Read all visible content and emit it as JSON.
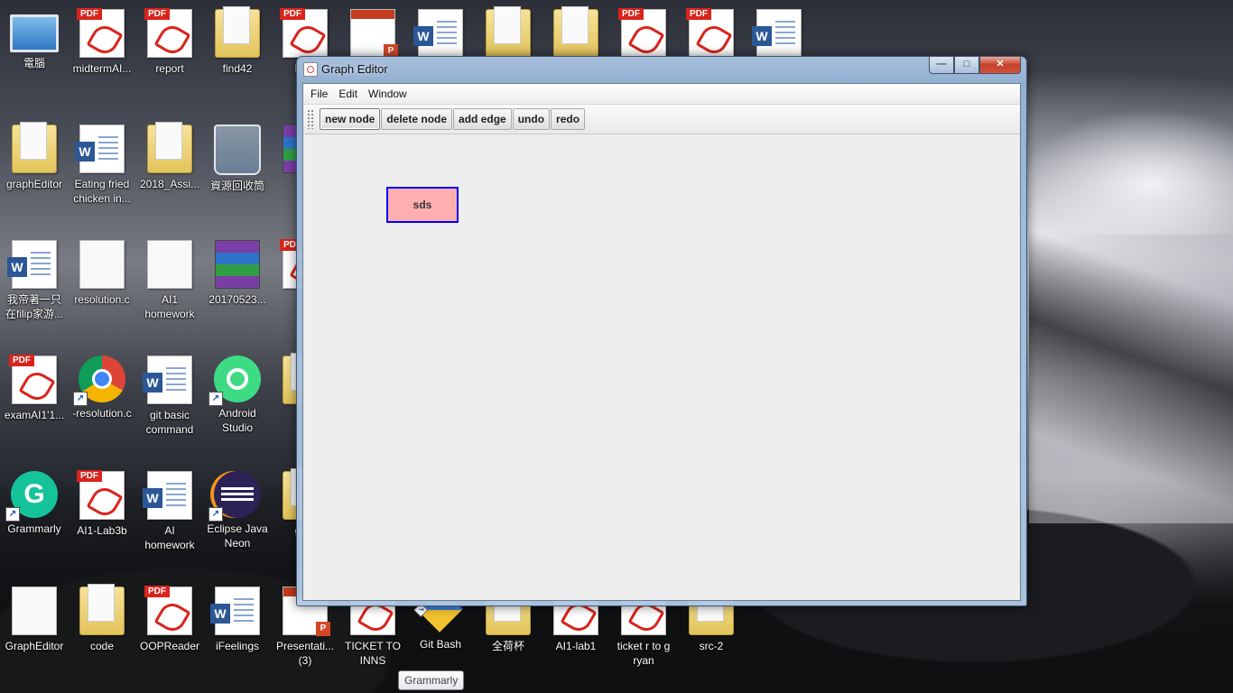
{
  "desktop": {
    "icons": [
      {
        "label": "電腦",
        "type": "computer"
      },
      {
        "label": "midtermAI...",
        "type": "pdf"
      },
      {
        "label": "report",
        "type": "pdf-folder"
      },
      {
        "label": "find42",
        "type": "folder"
      },
      {
        "label": "key-",
        "type": "pdf"
      },
      {
        "label": "",
        "type": "ppt"
      },
      {
        "label": "",
        "type": "word"
      },
      {
        "label": "",
        "type": "folder"
      },
      {
        "label": "",
        "type": "folder"
      },
      {
        "label": "",
        "type": "pdf"
      },
      {
        "label": "",
        "type": "pdf"
      },
      {
        "label": "",
        "type": "word"
      },
      {
        "label": "graphEditor",
        "type": "folder"
      },
      {
        "label": "Eating fried\nchicken in...",
        "type": "word"
      },
      {
        "label": "2018_Assi...",
        "type": "folder"
      },
      {
        "label": "資源回收筒",
        "type": "recycle"
      },
      {
        "label": "Pa",
        "type": "rar"
      },
      {
        "label": "我帝著一只\n在filip家游...",
        "type": "word"
      },
      {
        "label": "resolution.c",
        "type": "doc"
      },
      {
        "label": "AI1\nhomework",
        "type": "doc"
      },
      {
        "label": "20170523...",
        "type": "rar"
      },
      {
        "label": "Ry",
        "type": "pdf"
      },
      {
        "label": "examAI1'1...",
        "type": "pdf"
      },
      {
        "label": "-resolution.c",
        "type": "chrome"
      },
      {
        "label": "git basic\ncommand",
        "type": "word"
      },
      {
        "label": "Android\nStudio",
        "type": "android"
      },
      {
        "label": "N",
        "type": "folder"
      },
      {
        "label": "Grammarly",
        "type": "grammarly"
      },
      {
        "label": "AI1-Lab3b",
        "type": "pdf"
      },
      {
        "label": "AI\nhomework",
        "type": "word"
      },
      {
        "label": "Eclipse Java\nNeon",
        "type": "eclipse"
      },
      {
        "label": "glob",
        "type": "folder"
      },
      {
        "label": "GraphEditor",
        "type": "doc"
      },
      {
        "label": "code",
        "type": "folder"
      },
      {
        "label": "OOPReader",
        "type": "pdf"
      },
      {
        "label": "iFeelings",
        "type": "word"
      },
      {
        "label": "Presentati...\n(3)",
        "type": "ppt"
      },
      {
        "label": "TICKET TO\nINNS",
        "type": "pdf"
      },
      {
        "label": "Git Bash",
        "type": "git"
      },
      {
        "label": "全荷杯",
        "type": "folder"
      },
      {
        "label": "AI1-lab1",
        "type": "pdf"
      },
      {
        "label": "ticket r to g\nryan",
        "type": "pdf"
      },
      {
        "label": "src-2",
        "type": "folder"
      }
    ]
  },
  "window": {
    "title": "Graph Editor",
    "buttons": {
      "minimize": "—",
      "maximize": "□",
      "close": "✕"
    },
    "menu": [
      "File",
      "Edit",
      "Window"
    ],
    "toolbar": [
      "new node",
      "delete node",
      "add edge",
      "undo",
      "redo"
    ],
    "nodes": [
      {
        "label": "sds",
        "fill": "#ffafaf",
        "border": "#0000ff"
      }
    ]
  },
  "tooltip": {
    "text": "Grammarly"
  }
}
